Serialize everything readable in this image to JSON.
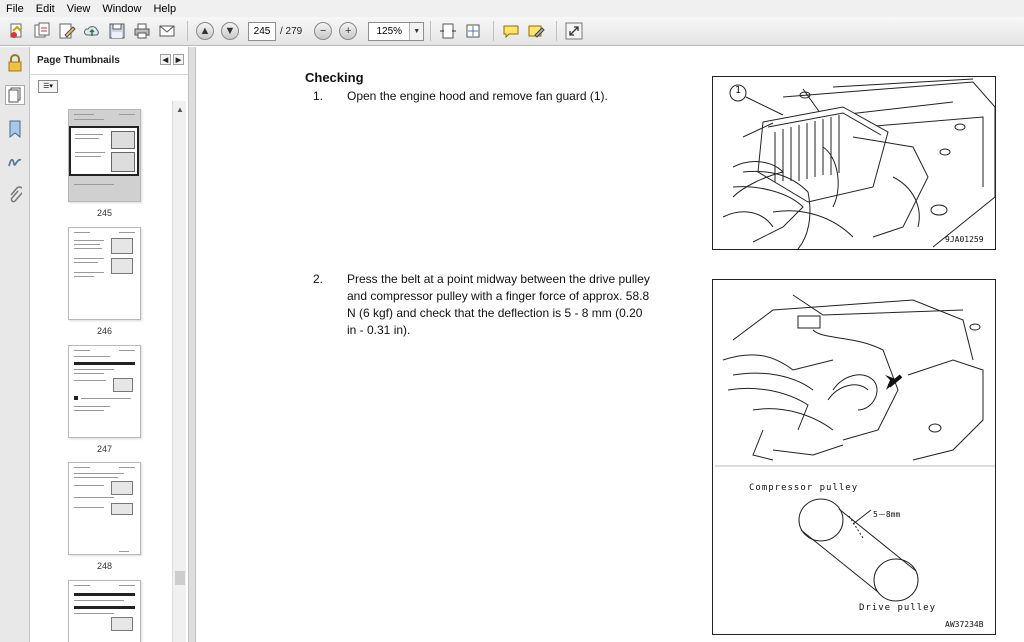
{
  "menu": {
    "items": [
      "File",
      "Edit",
      "View",
      "Window",
      "Help"
    ]
  },
  "toolbar": {
    "page_current": "245",
    "page_total": "/ 279",
    "zoom_value": "125%"
  },
  "sidebar": {
    "title": "Page Thumbnails",
    "thumbnails": [
      {
        "label": "245"
      },
      {
        "label": "246"
      },
      {
        "label": "247"
      },
      {
        "label": "248"
      }
    ]
  },
  "document": {
    "heading": "Checking",
    "steps": [
      {
        "num": "1.",
        "lines": [
          "Open the engine hood and remove fan guard (1)."
        ]
      },
      {
        "num": "2.",
        "lines": [
          "Press the belt at a point midway between the drive pulley",
          "and compressor pulley with a finger force of approx. 58.8",
          "N (6 kgf) and check that the deflection is 5 - 8 mm (0.20",
          "in - 0.31 in)."
        ]
      }
    ],
    "figures": [
      {
        "code": "9JA01259",
        "callout": "1"
      },
      {
        "code": "AW37234B",
        "label_top": "Compressor pulley",
        "label_mid": "5－8mm",
        "label_bottom": "Drive pulley"
      }
    ]
  }
}
